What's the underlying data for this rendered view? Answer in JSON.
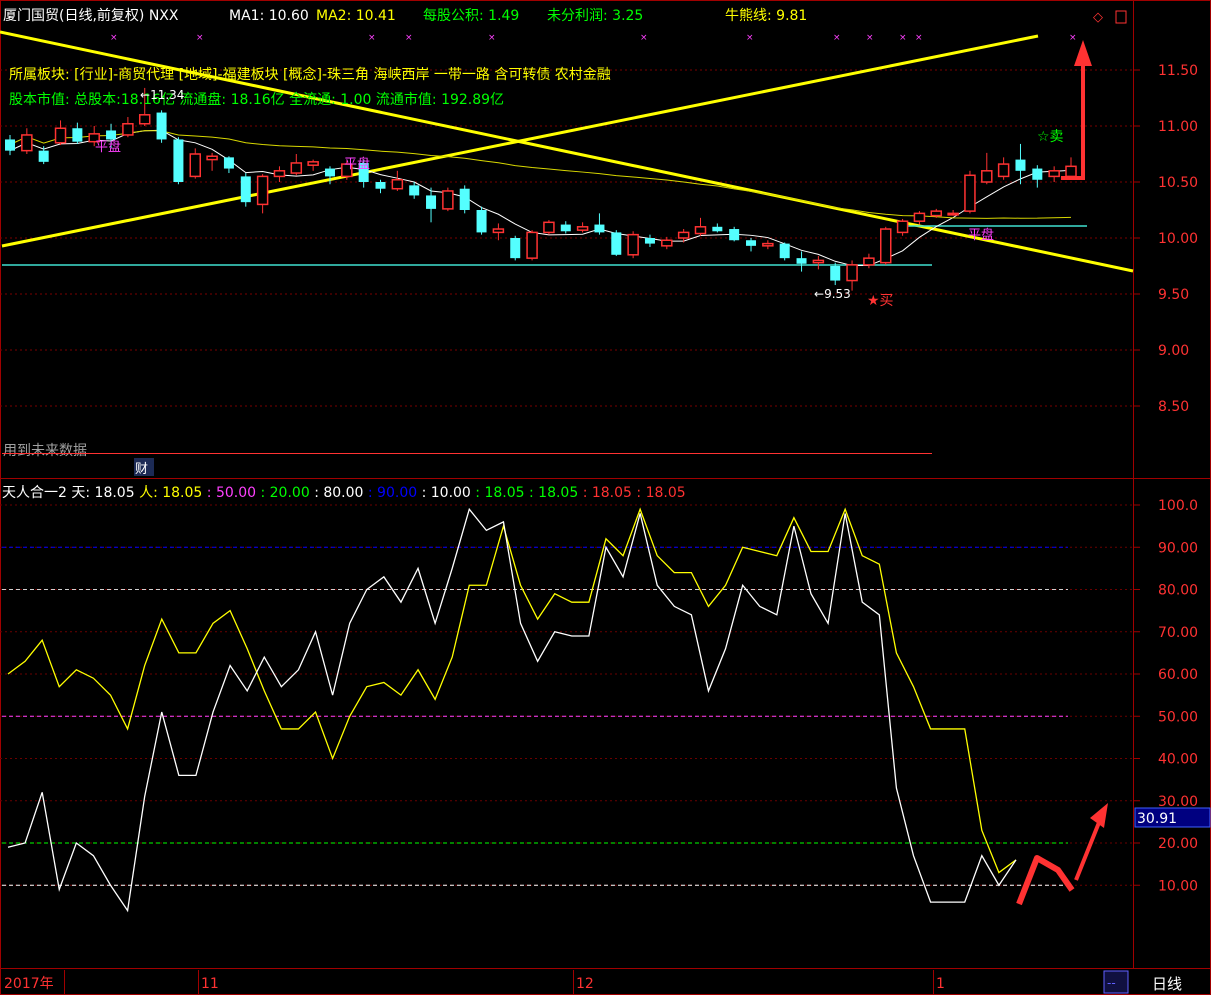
{
  "header": {
    "stock": "厦门国贸(日线,前复权)",
    "code": "NXX",
    "ma1": "MA1: 10.60",
    "ma2": "MA2: 10.41",
    "per_share_fund": "每股公积: 1.49",
    "undistributed": "未分利润: 3.25",
    "bull_bear": "牛熊线: 9.81"
  },
  "info": {
    "sector": "所属板块: [行业]-商贸代理 [地域]-福建板块 [概念]-珠三角 海峡西岸 一带一路 含可转债 农村金融",
    "capital": "股本市值: 总股本:18.16亿 流通盘: 18.16亿 全流通: 1.00 流通市值: 192.89亿"
  },
  "annotations": {
    "high": "11.34",
    "low": "9.53",
    "buy": "★买",
    "sell": "☆卖",
    "tag1": "平盘",
    "tag2": "平盘",
    "tag3": "平盘",
    "future_warning": "用到未来数据",
    "finance": "财"
  },
  "price_axis": [
    "11.50",
    "11.00",
    "10.50",
    "10.00",
    "9.50",
    "9.00",
    "8.50"
  ],
  "indicator": {
    "name": "天人合一2",
    "tian": "天: 18.05",
    "ren": "人: 18.05",
    "v50": ": 50.00",
    "v20": ": 20.00",
    "v80": ": 80.00",
    "v90": ": 90.00",
    "v10": ": 10.00",
    "va": ": 18.05",
    "vb": ": 18.05",
    "vc": ": 18.05",
    "vd": ": 18.05",
    "axis": [
      "100.0",
      "90.00",
      "80.00",
      "70.00",
      "60.00",
      "50.00",
      "40.00",
      "30.00",
      "20.00",
      "10.00"
    ],
    "cursor_value": "30.91"
  },
  "time_axis": {
    "labels": [
      "2017年",
      "11",
      "12",
      "1"
    ],
    "period": "日线",
    "dash": "--"
  },
  "colors": {
    "up": "#ff3232",
    "down": "#54ffff",
    "grid": "#800000",
    "yellow": "#ffff00",
    "white": "#ffffff"
  },
  "chart_data": [
    {
      "type": "candlestick",
      "ylim": [
        8.2,
        11.9
      ],
      "candles": [
        [
          10.88,
          10.78,
          10.92,
          10.74
        ],
        [
          10.78,
          10.92,
          10.98,
          10.75
        ],
        [
          10.78,
          10.68,
          10.82,
          10.66
        ],
        [
          10.85,
          10.98,
          11.05,
          10.83
        ],
        [
          10.98,
          10.86,
          11.03,
          10.84
        ],
        [
          10.86,
          10.93,
          11.0,
          10.82
        ],
        [
          10.96,
          10.88,
          11.02,
          10.8
        ],
        [
          10.92,
          11.02,
          11.08,
          10.9
        ],
        [
          11.02,
          11.1,
          11.34,
          11.0
        ],
        [
          11.12,
          10.88,
          11.14,
          10.85
        ],
        [
          10.88,
          10.5,
          10.9,
          10.48
        ],
        [
          10.55,
          10.75,
          10.8,
          10.53
        ],
        [
          10.7,
          10.73,
          10.76,
          10.6
        ],
        [
          10.72,
          10.62,
          10.73,
          10.58
        ],
        [
          10.55,
          10.32,
          10.58,
          10.28
        ],
        [
          10.3,
          10.55,
          10.57,
          10.22
        ],
        [
          10.55,
          10.6,
          10.64,
          10.5
        ],
        [
          10.58,
          10.67,
          10.75,
          10.56
        ],
        [
          10.65,
          10.68,
          10.7,
          10.6
        ],
        [
          10.62,
          10.55,
          10.64,
          10.48
        ],
        [
          10.55,
          10.66,
          10.69,
          10.52
        ],
        [
          10.67,
          10.5,
          10.7,
          10.45
        ],
        [
          10.5,
          10.44,
          10.52,
          10.4
        ],
        [
          10.44,
          10.52,
          10.6,
          10.42
        ],
        [
          10.47,
          10.38,
          10.5,
          10.35
        ],
        [
          10.38,
          10.26,
          10.45,
          10.14
        ],
        [
          10.26,
          10.42,
          10.45,
          10.24
        ],
        [
          10.44,
          10.25,
          10.47,
          10.22
        ],
        [
          10.25,
          10.05,
          10.28,
          10.03
        ],
        [
          10.05,
          10.08,
          10.13,
          9.98
        ],
        [
          10.0,
          9.82,
          10.02,
          9.8
        ],
        [
          9.82,
          10.05,
          10.07,
          9.8
        ],
        [
          10.05,
          10.14,
          10.16,
          10.03
        ],
        [
          10.12,
          10.06,
          10.15,
          10.04
        ],
        [
          10.07,
          10.1,
          10.14,
          10.05
        ],
        [
          10.12,
          10.05,
          10.22,
          10.03
        ],
        [
          10.05,
          9.85,
          10.07,
          9.84
        ],
        [
          9.85,
          10.03,
          10.06,
          9.82
        ],
        [
          10.0,
          9.95,
          10.03,
          9.92
        ],
        [
          9.93,
          9.98,
          10.01,
          9.9
        ],
        [
          10.0,
          10.05,
          10.08,
          9.96
        ],
        [
          10.04,
          10.1,
          10.18,
          10.02
        ],
        [
          10.1,
          10.06,
          10.13,
          10.05
        ],
        [
          10.08,
          9.98,
          10.1,
          9.97
        ],
        [
          9.98,
          9.93,
          10.0,
          9.88
        ],
        [
          9.93,
          9.95,
          9.98,
          9.9
        ],
        [
          9.95,
          9.82,
          9.96,
          9.8
        ],
        [
          9.82,
          9.77,
          9.88,
          9.7
        ],
        [
          9.78,
          9.8,
          9.84,
          9.72
        ],
        [
          9.75,
          9.62,
          9.78,
          9.58
        ],
        [
          9.62,
          9.76,
          9.8,
          9.53
        ],
        [
          9.76,
          9.82,
          9.86,
          9.73
        ],
        [
          9.78,
          10.08,
          10.1,
          9.76
        ],
        [
          10.05,
          10.15,
          10.17,
          10.02
        ],
        [
          10.15,
          10.22,
          10.24,
          10.12
        ],
        [
          10.2,
          10.24,
          10.26,
          10.18
        ],
        [
          10.22,
          10.22,
          10.25,
          10.2
        ],
        [
          10.24,
          10.56,
          10.6,
          10.22
        ],
        [
          10.5,
          10.6,
          10.76,
          10.48
        ],
        [
          10.55,
          10.66,
          10.72,
          10.52
        ],
        [
          10.7,
          10.6,
          10.84,
          10.48
        ],
        [
          10.62,
          10.52,
          10.65,
          10.45
        ],
        [
          10.55,
          10.6,
          10.64,
          10.5
        ],
        [
          10.55,
          10.64,
          10.72,
          10.52
        ]
      ]
    },
    {
      "type": "line",
      "ylim": [
        5,
        102
      ],
      "series": [
        {
          "color": "#ffff00",
          "values": [
            60,
            63,
            68,
            57,
            61,
            59,
            55,
            47,
            62,
            73,
            65,
            65,
            72,
            75,
            66,
            56,
            47,
            47,
            51,
            40,
            50,
            57,
            58,
            55,
            61,
            54,
            64,
            81,
            81,
            95,
            81,
            73,
            79,
            77,
            77,
            92,
            88,
            99,
            88,
            84,
            84,
            76,
            81,
            90,
            89,
            88,
            97,
            89,
            89,
            99,
            88,
            86,
            65,
            57,
            47,
            47,
            47,
            23,
            13,
            16
          ]
        },
        {
          "color": "#ffffff",
          "values": [
            19,
            20,
            32,
            9,
            20,
            17,
            10,
            4,
            31,
            51,
            36,
            36,
            51,
            62,
            56,
            64,
            57,
            61,
            70,
            55,
            72,
            80,
            83,
            77,
            85,
            72,
            85,
            99,
            94,
            96,
            72,
            63,
            70,
            69,
            69,
            90,
            83,
            98,
            81,
            76,
            74,
            56,
            66,
            81,
            76,
            74,
            95,
            79,
            72,
            98,
            77,
            74,
            33,
            17,
            6,
            6,
            6,
            17,
            10,
            16
          ]
        }
      ]
    }
  ]
}
